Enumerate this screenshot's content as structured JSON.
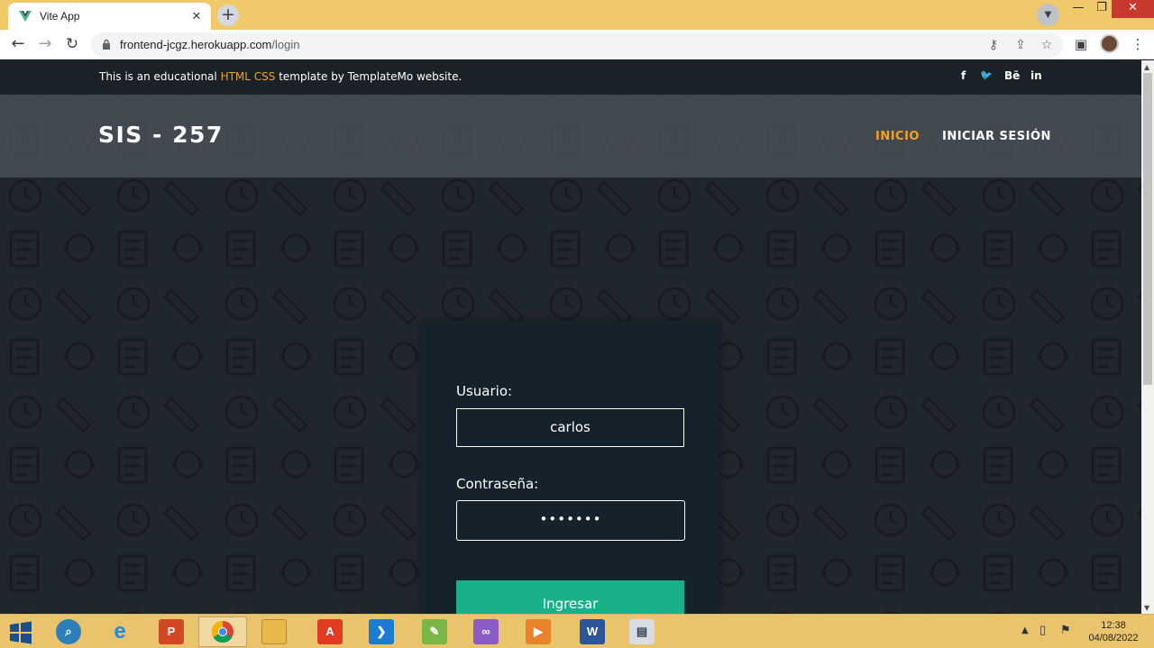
{
  "browser": {
    "tab_title": "Vite App",
    "tab_close": "✕",
    "new_tab": "+",
    "url_domain": "frontend-jcgz.herokuapp.com",
    "url_path": "/login",
    "window_minimize": "—",
    "window_maximize": "❐",
    "window_close": "✕"
  },
  "infobar": {
    "text_before": "This is an educational ",
    "highlight": "HTML CSS",
    "text_after": " template by TemplateMo website.",
    "social": [
      "f",
      "🐦",
      "Bē",
      "in"
    ]
  },
  "header": {
    "logo": "SIS - 257",
    "nav": [
      "INICIO",
      "INICIAR SESIÓN"
    ]
  },
  "login": {
    "user_label": "Usuario:",
    "user_value": "carlos",
    "pass_label": "Contraseña:",
    "pass_value": "•••••••",
    "submit_label": "Ingresar"
  },
  "taskbar": {
    "clock_time": "12:38",
    "clock_date": "04/08/2022"
  },
  "colors": {
    "accent_orange": "#f6a21a",
    "button_green": "#1ab08a",
    "taskbar": "#e9c46d"
  }
}
